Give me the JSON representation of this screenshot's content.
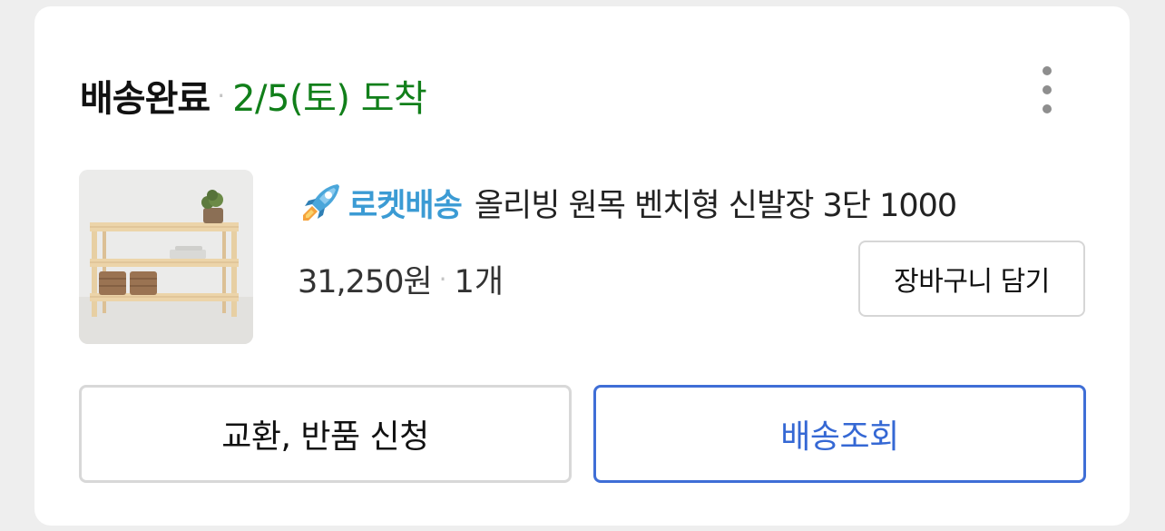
{
  "order": {
    "status": "배송완료",
    "separator": "·",
    "arrival_text": "2/5(토) 도착",
    "arrival_color": "#117f1a",
    "more_icon": "more-vertical-icon"
  },
  "product": {
    "badge_icon": "rocket-icon",
    "badge_label": "로켓배송",
    "badge_color": "#3b9bd4",
    "name": "올리빙 원목 벤치형 신발장 3단 1000",
    "price": "31,250원",
    "separator": "·",
    "quantity": "1개",
    "image": "shoe-rack-thumbnail"
  },
  "buttons": {
    "add_to_cart": "장바구니 담기",
    "exchange_return": "교환, 반품 신청",
    "track_delivery": "배송조회",
    "track_color": "#3568d4"
  }
}
